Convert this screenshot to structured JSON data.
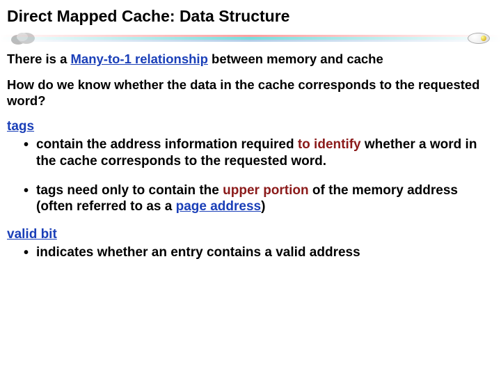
{
  "title": "Direct Mapped Cache: Data Structure",
  "line1": {
    "pre": "There is a ",
    "rel": "Many-to-1 relationship",
    "post": " between memory and cache"
  },
  "line2": "How do we know whether the data in the cache corresponds to the requested word?",
  "tags": {
    "heading": "tags",
    "b1": {
      "pre": "contain the address information required ",
      "em": "to identify",
      "post": " whether a word in  the cache corresponds to the requested word."
    },
    "b2": {
      "pre": "tags need only to contain the ",
      "em1": "upper portion",
      "mid": " of the memory address (often referred to as a  ",
      "em2": "page address",
      "post": ")"
    }
  },
  "valid": {
    "heading": "valid bit",
    "b1": "indicates whether an entry contains a valid address"
  }
}
